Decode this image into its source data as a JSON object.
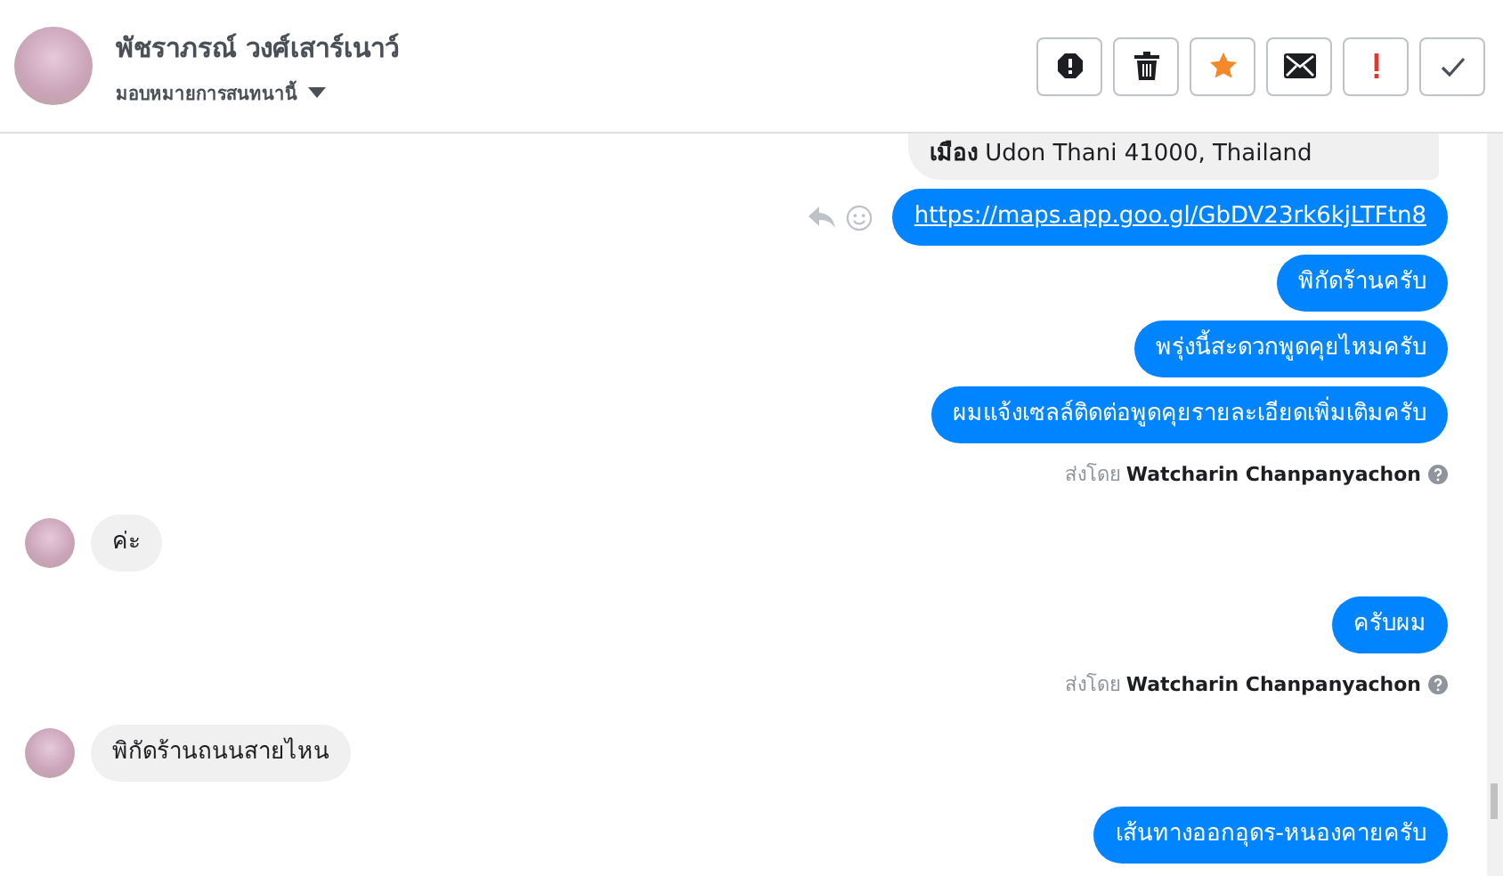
{
  "header": {
    "name": "พัชราภรณ์ วงศ์เสาร์เนาว์",
    "subtitle": "มอบหมายการสนทนานี้"
  },
  "toolbar": [
    {
      "kind": "alert"
    },
    {
      "kind": "trash"
    },
    {
      "kind": "star"
    },
    {
      "kind": "envelope"
    },
    {
      "kind": "exclaim"
    },
    {
      "kind": "check"
    }
  ],
  "messages": [
    {
      "kind": "location",
      "outgoing": true,
      "text": "**เมือง** Udon Thani 41000, Thailand"
    },
    {
      "kind": "link",
      "outgoing": true,
      "text": "https://maps.app.goo.gl/GbDV23rk6kjLTFtn8",
      "show_actions": true
    },
    {
      "kind": "text",
      "outgoing": true,
      "text": "พิกัดร้านครับ"
    },
    {
      "kind": "text",
      "outgoing": true,
      "text": "พรุ่งนี้สะดวกพูดคุยไหมครับ"
    },
    {
      "kind": "text",
      "outgoing": true,
      "text": "ผมแจ้งเซลล์ติดต่อพูดคุยรายละเอียดเพิ่มเติมครับ"
    },
    {
      "kind": "sent_by",
      "outgoing": true,
      "text": "ส่งโดย **Watcharin Chanpanyachon**"
    },
    {
      "kind": "text",
      "outgoing": false,
      "text": "ค่ะ"
    },
    {
      "kind": "text",
      "outgoing": true,
      "text": "ครับผม"
    },
    {
      "kind": "sent_by",
      "outgoing": true,
      "text": "ส่งโดย **Watcharin Chanpanyachon**"
    },
    {
      "kind": "text",
      "outgoing": false,
      "text": "พิกัดร้านถนนสายไหน"
    },
    {
      "kind": "text",
      "outgoing": true,
      "text": "เส้นทางออกอุดร-หนองคายครับ"
    }
  ]
}
